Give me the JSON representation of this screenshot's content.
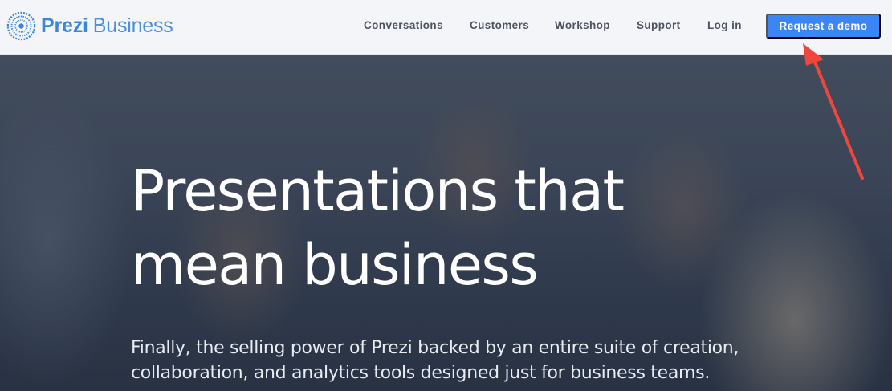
{
  "header": {
    "logo_bold": "Prezi",
    "logo_light": "Business",
    "nav": [
      {
        "label": "Conversations"
      },
      {
        "label": "Customers"
      },
      {
        "label": "Workshop"
      },
      {
        "label": "Support"
      },
      {
        "label": "Log in"
      }
    ],
    "cta_label": "Request a demo"
  },
  "hero": {
    "title": "Presentations that mean business",
    "subtitle": "Finally, the selling power of Prezi backed by an entire suite of creation, collaboration, and analytics tools designed just for business teams."
  },
  "colors": {
    "brand": "#3b86d8",
    "cta": "#3b86f7",
    "annotation_arrow": "#f0473d"
  },
  "icons": {
    "logo": "prezi-logo-icon",
    "annotation": "red-arrow-annotation"
  }
}
